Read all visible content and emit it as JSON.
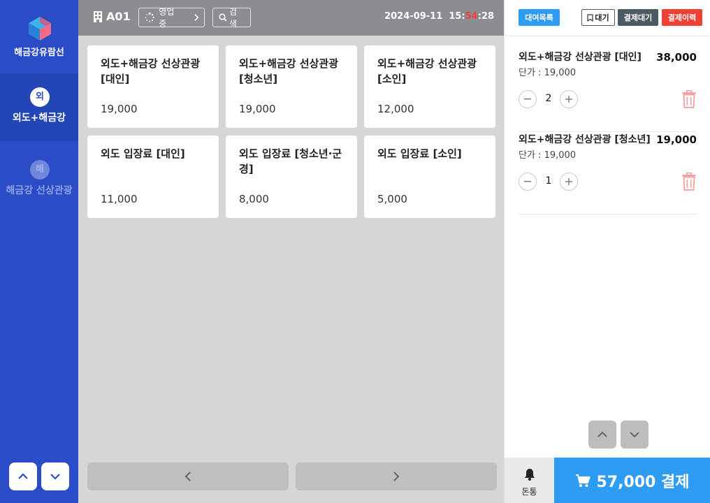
{
  "brand": {
    "name": "해금강유람선",
    "icon": "cube-logo-icon"
  },
  "sidebar": {
    "items": [
      {
        "initial": "외",
        "label": "외도+해금강",
        "active": true
      },
      {
        "initial": "해",
        "label": "해금강 선상관광",
        "active": false
      }
    ],
    "up_icon": "chevron-up-icon",
    "down_icon": "chevron-down-icon"
  },
  "topbar": {
    "table_no": "A01",
    "status_label": "영업중",
    "search_label": "검색",
    "date": "2024-09-11",
    "time_prefix": "15:",
    "time_minutes": "54",
    "time_suffix": ":28"
  },
  "products": [
    {
      "name": "외도+해금강 선상관광 [대인]",
      "price": "19,000"
    },
    {
      "name": "외도+해금강 선상관광 [청소년]",
      "price": "19,000"
    },
    {
      "name": "외도+해금강 선상관광 [소인]",
      "price": "12,000"
    },
    {
      "name": "외도 입장료 [대인]",
      "price": "11,000"
    },
    {
      "name": "외도 입장료 [청소년·군경]",
      "price": "8,000"
    },
    {
      "name": "외도 입장료 [소인]",
      "price": "5,000"
    }
  ],
  "right": {
    "rent_list": "대여목록",
    "wait": "대기",
    "pay_wait": "결제대기",
    "pay_history": "결제이력",
    "orders": [
      {
        "name": "외도+해금강 선상관광 [대인]",
        "unit": "단가 : 19,000",
        "qty": "2",
        "total": "38,000"
      },
      {
        "name": "외도+해금강 선상관광 [청소년]",
        "unit": "단가 : 19,000",
        "qty": "1",
        "total": "19,000"
      }
    ],
    "bell_label": "돈통",
    "pay_label": "57,000 결제"
  },
  "colors": {
    "sidebar": "#2a4dc7",
    "topbar": "#8a8e93",
    "accent_blue": "#2e9cf3",
    "danger": "#ee4136",
    "dark_btn": "#4b5a63"
  }
}
